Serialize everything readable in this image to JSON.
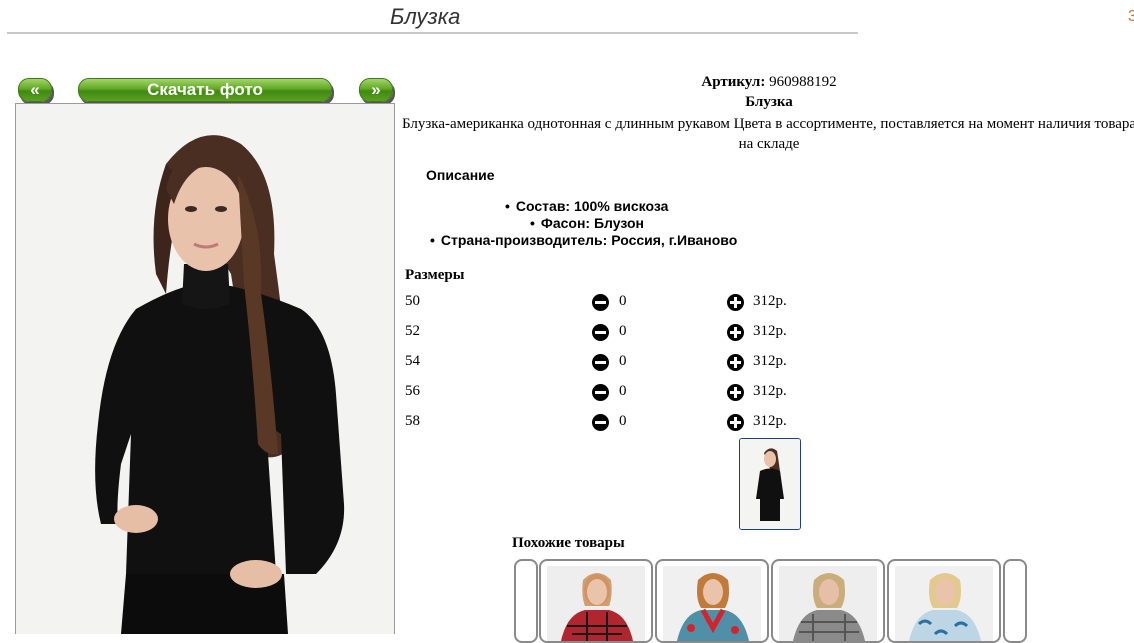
{
  "page": {
    "title": "Блузка"
  },
  "gallery": {
    "prev_label": "«",
    "download_label": "Скачать фото",
    "next_label": "»"
  },
  "product": {
    "article_label": "Артикул:",
    "article_value": "960988192",
    "name": "Блузка",
    "description": "Блузка-американка однотонная с длинным рукавом Цвета в ассортименте, поставляется на момент наличия товара на складе",
    "description_heading": "Описание",
    "specs": [
      "Состав: 100% вискоза",
      "Фасон: Блузон",
      "Страна-производитель: Россия, г.Иваново"
    ]
  },
  "sizes": {
    "heading": "Размеры",
    "rows": [
      {
        "size": "50",
        "qty": "0",
        "price": "312р."
      },
      {
        "size": "52",
        "qty": "0",
        "price": "312р."
      },
      {
        "size": "54",
        "qty": "0",
        "price": "312р."
      },
      {
        "size": "56",
        "qty": "0",
        "price": "312р."
      },
      {
        "size": "58",
        "qty": "0",
        "price": "312р."
      }
    ]
  },
  "similar": {
    "heading": "Похожие товары"
  },
  "colors": {
    "button_green": "#5da021",
    "thumb_border": "#1f3f7a",
    "corner_mark": "#d0702a"
  },
  "icons": [
    "minus-circle-icon",
    "plus-circle-icon",
    "prev-arrow-icon",
    "next-arrow-icon"
  ]
}
